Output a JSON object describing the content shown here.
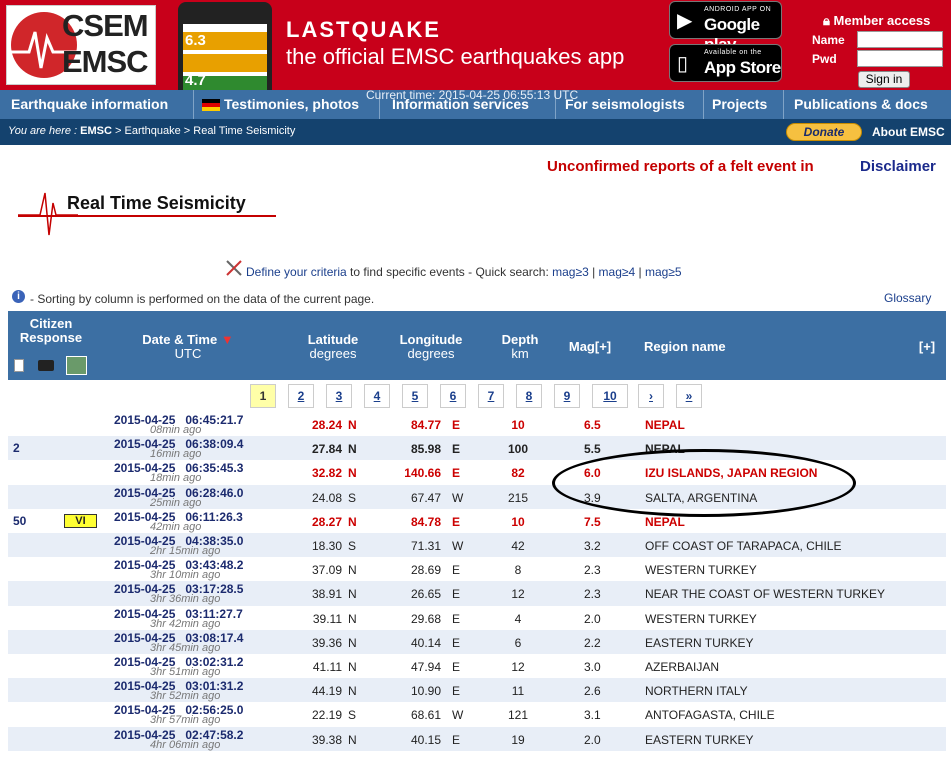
{
  "header": {
    "logo_line1": "CSEM",
    "logo_line2": "EMSC",
    "promo_title": "LASTQUAKE",
    "promo_sub": "the official EMSC earthquakes app",
    "phone_mags": [
      "6.3",
      "4.7"
    ],
    "google_play_small": "ANDROID APP ON",
    "google_play_big": "Google play",
    "app_store_small": "Available on the",
    "app_store_big": "App Store",
    "member_access": "Member access",
    "name_label": "Name",
    "pwd_label": "Pwd",
    "signin": "Sign in"
  },
  "nav": {
    "current_time": "Current time: 2015-04-25 06:55:13 UTC",
    "items": [
      "Earthquake information",
      "Testimonies, photos",
      "Information services",
      "For seismologists",
      "Projects",
      "Publications & docs"
    ]
  },
  "breadcrumb": {
    "prefix": "You are here :",
    "root": "EMSC",
    "trail": " > Earthquake > Real Time Seismicity",
    "donate": "Donate",
    "about": "About EMSC"
  },
  "banner": {
    "unconfirmed": "Unconfirmed reports of a felt event in",
    "disclaimer": "Disclaimer"
  },
  "page_title": "Real Time Seismicity",
  "criteria": {
    "link": "Define your criteria",
    "text": " to find specific events - Quick search: ",
    "q1": "mag≥3",
    "q2": "mag≥4",
    "q3": "mag≥5"
  },
  "sort_note": "- Sorting by column is performed on the data of the current page.",
  "glossary": "Glossary",
  "table": {
    "headers": {
      "citizen": "Citizen Response",
      "datetime": "Date & Time",
      "utc": "UTC",
      "lat": "Latitude",
      "lat_unit": "degrees",
      "lon": "Longitude",
      "lon_unit": "degrees",
      "depth": "Depth",
      "depth_unit": "km",
      "mag": "Mag[+]",
      "region": "Region name",
      "expand": "[+]"
    },
    "pages": [
      "1",
      "2",
      "3",
      "4",
      "5",
      "6",
      "7",
      "8",
      "9",
      "10",
      "›",
      "»"
    ],
    "current_page": "1",
    "rows": [
      {
        "cit": "",
        "int": "",
        "dt": "2015-04-25   06:45:21.7",
        "ago": "08min ago",
        "lat": "28.24",
        "ns": "N",
        "lon": "84.77",
        "ew": "E",
        "dep": "10",
        "mag": "6.5",
        "reg": "NEPAL",
        "style": "red"
      },
      {
        "cit": "2",
        "int": "",
        "dt": "2015-04-25   06:38:09.4",
        "ago": "16min ago",
        "lat": "27.84",
        "ns": "N",
        "lon": "85.98",
        "ew": "E",
        "dep": "100",
        "mag": "5.5",
        "reg": "NEPAL",
        "style": "bold"
      },
      {
        "cit": "",
        "int": "",
        "dt": "2015-04-25   06:35:45.3",
        "ago": "18min ago",
        "lat": "32.82",
        "ns": "N",
        "lon": "140.66",
        "ew": "E",
        "dep": "82",
        "mag": "6.0",
        "reg": "IZU ISLANDS, JAPAN REGION",
        "style": "red"
      },
      {
        "cit": "",
        "int": "",
        "dt": "2015-04-25   06:28:46.0",
        "ago": "25min ago",
        "lat": "24.08",
        "ns": "S",
        "lon": "67.47",
        "ew": "W",
        "dep": "215",
        "mag": "3.9",
        "reg": "SALTA, ARGENTINA",
        "style": ""
      },
      {
        "cit": "50",
        "int": "VI",
        "dt": "2015-04-25   06:11:26.3",
        "ago": "42min ago",
        "lat": "28.27",
        "ns": "N",
        "lon": "84.78",
        "ew": "E",
        "dep": "10",
        "mag": "7.5",
        "reg": "NEPAL",
        "style": "red"
      },
      {
        "cit": "",
        "int": "",
        "dt": "2015-04-25   04:38:35.0",
        "ago": "2hr 15min ago",
        "lat": "18.30",
        "ns": "S",
        "lon": "71.31",
        "ew": "W",
        "dep": "42",
        "mag": "3.2",
        "reg": "OFF COAST OF TARAPACA, CHILE",
        "style": ""
      },
      {
        "cit": "",
        "int": "",
        "dt": "2015-04-25   03:43:48.2",
        "ago": "3hr 10min ago",
        "lat": "37.09",
        "ns": "N",
        "lon": "28.69",
        "ew": "E",
        "dep": "8",
        "mag": "2.3",
        "reg": "WESTERN TURKEY",
        "style": ""
      },
      {
        "cit": "",
        "int": "",
        "dt": "2015-04-25   03:17:28.5",
        "ago": "3hr 36min ago",
        "lat": "38.91",
        "ns": "N",
        "lon": "26.65",
        "ew": "E",
        "dep": "12",
        "mag": "2.3",
        "reg": "NEAR THE COAST OF WESTERN TURKEY",
        "style": ""
      },
      {
        "cit": "",
        "int": "",
        "dt": "2015-04-25   03:11:27.7",
        "ago": "3hr 42min ago",
        "lat": "39.11",
        "ns": "N",
        "lon": "29.68",
        "ew": "E",
        "dep": "4",
        "mag": "2.0",
        "reg": "WESTERN TURKEY",
        "style": ""
      },
      {
        "cit": "",
        "int": "",
        "dt": "2015-04-25   03:08:17.4",
        "ago": "3hr 45min ago",
        "lat": "39.36",
        "ns": "N",
        "lon": "40.14",
        "ew": "E",
        "dep": "6",
        "mag": "2.2",
        "reg": "EASTERN TURKEY",
        "style": ""
      },
      {
        "cit": "",
        "int": "",
        "dt": "2015-04-25   03:02:31.2",
        "ago": "3hr 51min ago",
        "lat": "41.11",
        "ns": "N",
        "lon": "47.94",
        "ew": "E",
        "dep": "12",
        "mag": "3.0",
        "reg": "AZERBAIJAN",
        "style": ""
      },
      {
        "cit": "",
        "int": "",
        "dt": "2015-04-25   03:01:31.2",
        "ago": "3hr 52min ago",
        "lat": "44.19",
        "ns": "N",
        "lon": "10.90",
        "ew": "E",
        "dep": "11",
        "mag": "2.6",
        "reg": "NORTHERN ITALY",
        "style": ""
      },
      {
        "cit": "",
        "int": "",
        "dt": "2015-04-25   02:56:25.0",
        "ago": "3hr 57min ago",
        "lat": "22.19",
        "ns": "S",
        "lon": "68.61",
        "ew": "W",
        "dep": "121",
        "mag": "3.1",
        "reg": "ANTOFAGASTA, CHILE",
        "style": ""
      },
      {
        "cit": "",
        "int": "",
        "dt": "2015-04-25   02:47:58.2",
        "ago": "4hr 06min ago",
        "lat": "39.38",
        "ns": "N",
        "lon": "40.15",
        "ew": "E",
        "dep": "19",
        "mag": "2.0",
        "reg": "EASTERN TURKEY",
        "style": ""
      }
    ]
  }
}
